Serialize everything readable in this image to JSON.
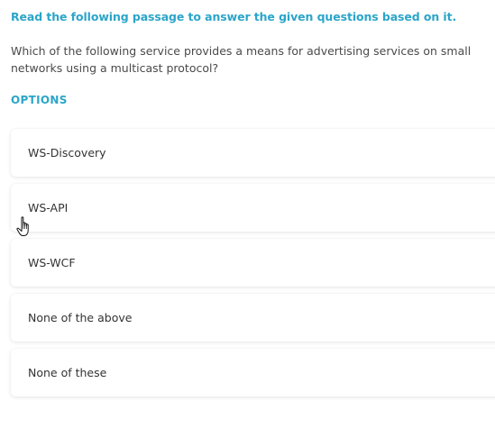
{
  "instruction": "Read the following passage to answer the given questions based on it.",
  "question": "Which of the following service provides a means for advertising services on small networks using a multicast protocol?",
  "options_label": "OPTIONS",
  "options": [
    {
      "label": "WS-Discovery"
    },
    {
      "label": "WS-API"
    },
    {
      "label": "WS-WCF"
    },
    {
      "label": "None of the above"
    },
    {
      "label": "None of these"
    }
  ],
  "colors": {
    "accent": "#2ba5c9",
    "text": "#4a4a4a"
  },
  "cursor_icon": "hand-pointer-icon"
}
